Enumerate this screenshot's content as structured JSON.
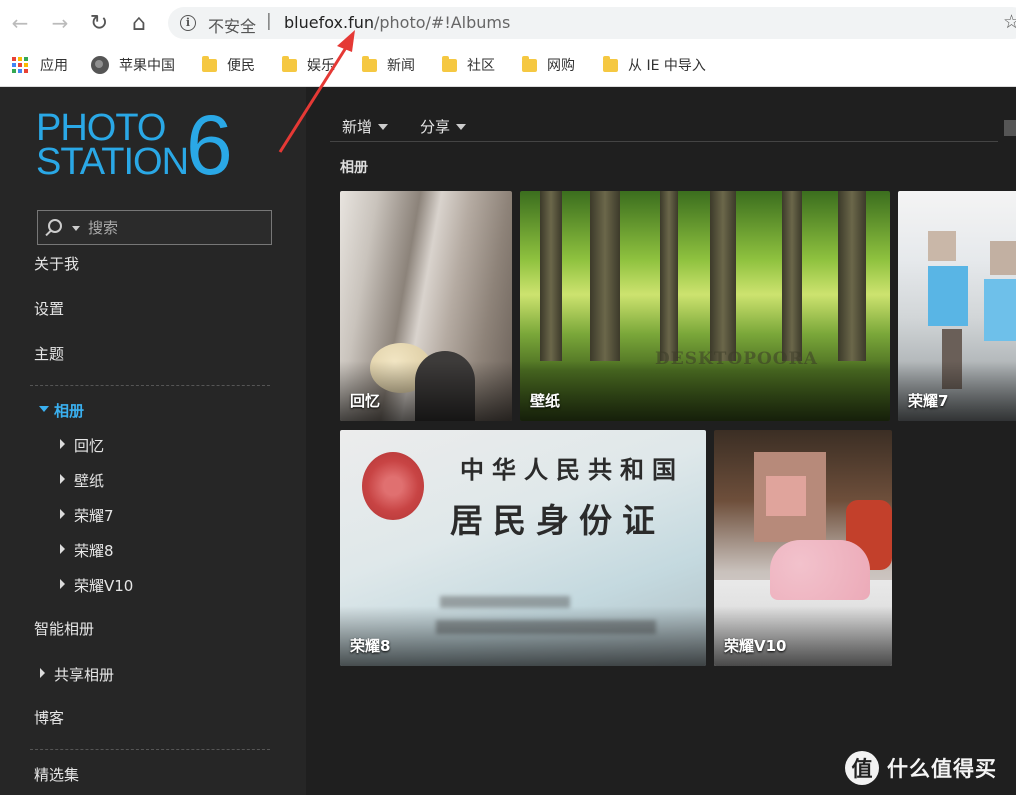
{
  "browser": {
    "back_icon": "←",
    "forward_icon": "→",
    "reload_icon": "↻",
    "home_icon": "⌂",
    "info_glyph": "i",
    "security_text": "不安全",
    "separator": "|",
    "url_host": "bluefox.fun",
    "url_path": "/photo/#!Albums",
    "star_icon": "☆",
    "bookmarks": [
      {
        "label": "应用",
        "icon": "apps-grid-icon"
      },
      {
        "label": "苹果中国",
        "icon": "globe-icon"
      },
      {
        "label": "便民",
        "icon": "folder-icon"
      },
      {
        "label": "娱乐",
        "icon": "folder-icon"
      },
      {
        "label": "新闻",
        "icon": "folder-icon"
      },
      {
        "label": "社区",
        "icon": "folder-icon"
      },
      {
        "label": "网购",
        "icon": "folder-icon"
      },
      {
        "label": "从 IE 中导入",
        "icon": "folder-icon"
      }
    ]
  },
  "logo": {
    "line1": "PHOTO",
    "line2": "STATION",
    "version": "6",
    "color": "#2aa8e6"
  },
  "sidebar": {
    "search_placeholder": "搜索",
    "items": {
      "about": "关于我",
      "settings": "设置",
      "theme": "主题",
      "albums": "相册",
      "smart_albums": "智能相册",
      "shared_albums": "共享相册",
      "blog": "博客",
      "featured": "精选集"
    },
    "album_children": [
      "回忆",
      "壁纸",
      "荣耀7",
      "荣耀8",
      "荣耀V10"
    ],
    "active_color": "#3ab0f0"
  },
  "toolbar": {
    "add_label": "新增",
    "share_label": "分享"
  },
  "section_title": "相册",
  "albums": [
    {
      "name": "回忆"
    },
    {
      "name": "壁纸",
      "watermark_text": "DESKTOPOORA"
    },
    {
      "name": "荣耀7"
    },
    {
      "name": "荣耀8",
      "id_card_text_line1": "中华人民共和国",
      "id_card_text_line2": "居民身份证"
    },
    {
      "name": "荣耀V10"
    }
  ],
  "watermark": {
    "badge": "值",
    "text": "什么值得买"
  }
}
